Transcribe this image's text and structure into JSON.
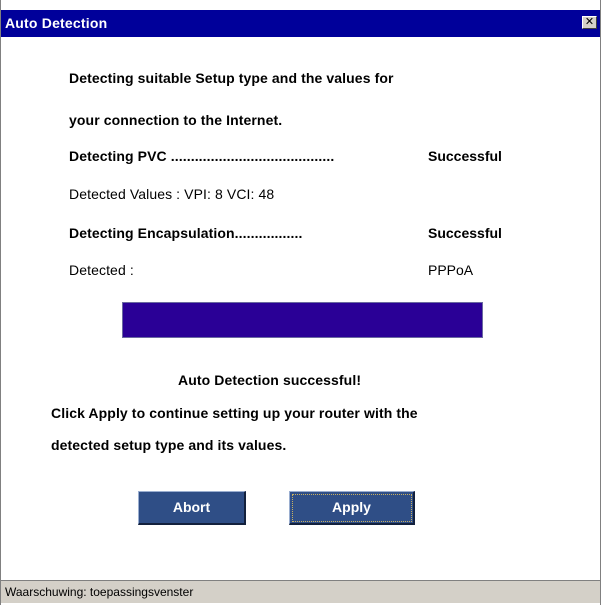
{
  "window": {
    "title": "Auto Detection",
    "close_glyph": "✕",
    "close_icon": "close-icon"
  },
  "content": {
    "intro_line1": "Detecting suitable Setup type and the values for",
    "intro_line2": "your connection to the Internet.",
    "pvc_label": "Detecting PVC .........................................",
    "pvc_status": "Successful",
    "detected_values": "Detected Values : VPI: 8  VCI: 48",
    "encap_label": "Detecting Encapsulation.................",
    "encap_status": "Successful",
    "detected_label": "Detected :",
    "detected_value": "PPPoA",
    "progress_percent": 100,
    "result_message": "Auto Detection successful!",
    "instruction_line1": "Click Apply to continue setting up your router with the",
    "instruction_line2": "detected setup type and its values."
  },
  "buttons": {
    "abort_label": "Abort",
    "apply_label": "Apply"
  },
  "statusbar": {
    "text": "Waarschuwing: toepassingsvenster"
  },
  "colors": {
    "titlebar": "#00009a",
    "progress": "#2a0096",
    "button": "#2f4e86",
    "statusbar": "#d4d0c8"
  }
}
